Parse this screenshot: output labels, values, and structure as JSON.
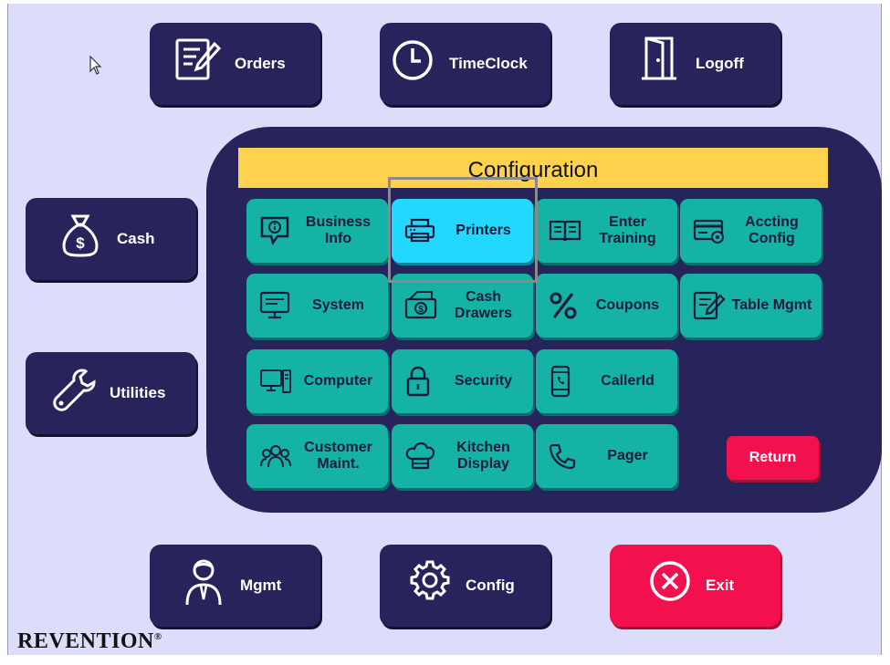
{
  "top_buttons": {
    "orders": "Orders",
    "timeclock": "TimeClock",
    "logoff": "Logoff"
  },
  "side_buttons": {
    "cash": "Cash",
    "utilities": "Utilities"
  },
  "bottom_buttons": {
    "mgmt": "Mgmt",
    "config": "Config",
    "exit": "Exit"
  },
  "config_panel": {
    "title": "Configuration",
    "tiles": [
      {
        "label": "Business Info",
        "icon": "info-bubble-icon"
      },
      {
        "label": "Printers",
        "icon": "printer-icon",
        "selected": true
      },
      {
        "label": "Enter Training",
        "icon": "book-icon"
      },
      {
        "label": "Accting Config",
        "icon": "credit-card-icon"
      },
      {
        "label": "System",
        "icon": "monitor-icon"
      },
      {
        "label": "Cash Drawers",
        "icon": "cash-drawer-icon"
      },
      {
        "label": "Coupons",
        "icon": "percent-icon"
      },
      {
        "label": "Table Mgmt",
        "icon": "edit-note-icon"
      },
      {
        "label": "Computer",
        "icon": "computer-icon"
      },
      {
        "label": "Security",
        "icon": "lock-icon"
      },
      {
        "label": "CallerId",
        "icon": "mobile-phone-icon"
      },
      {
        "label": "Customer Maint.",
        "icon": "people-group-icon"
      },
      {
        "label": "Kitchen Display",
        "icon": "chef-hat-icon"
      },
      {
        "label": "Pager",
        "icon": "phone-handset-icon"
      }
    ],
    "return": "Return"
  },
  "brand": "REVENTION",
  "colors": {
    "background": "#dcdcfb",
    "navy": "#26245a",
    "teal": "#14b3a6",
    "selected": "#22d8ff",
    "header_yellow": "#ffd24d",
    "exit_red": "#f2104f"
  }
}
